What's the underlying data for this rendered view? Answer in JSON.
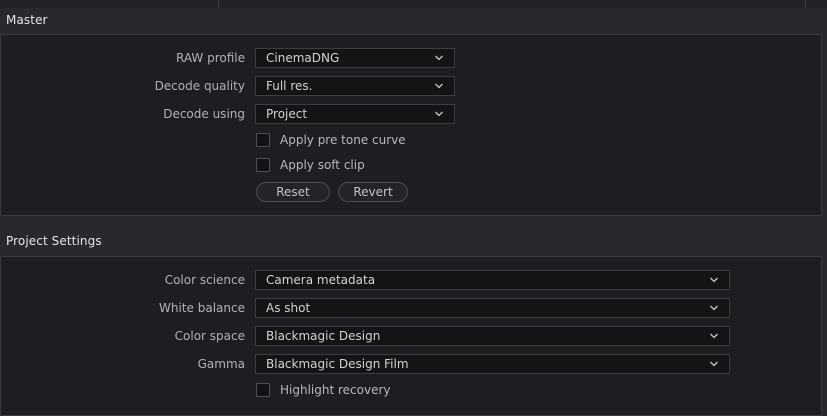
{
  "master": {
    "title": "Master",
    "rows": [
      {
        "label": "RAW profile",
        "value": "CinemaDNG"
      },
      {
        "label": "Decode quality",
        "value": "Full res."
      },
      {
        "label": "Decode using",
        "value": "Project"
      }
    ],
    "checkboxes": [
      {
        "label": "Apply pre tone curve",
        "checked": false
      },
      {
        "label": "Apply soft clip",
        "checked": false
      }
    ],
    "buttons": {
      "reset": "Reset",
      "revert": "Revert"
    }
  },
  "project_settings": {
    "title": "Project Settings",
    "rows": [
      {
        "label": "Color science",
        "value": "Camera metadata"
      },
      {
        "label": "White balance",
        "value": "As shot"
      },
      {
        "label": "Color space",
        "value": "Blackmagic Design"
      },
      {
        "label": "Gamma",
        "value": "Blackmagic Design Film"
      }
    ],
    "checkboxes": [
      {
        "label": "Highlight recovery",
        "checked": false
      }
    ]
  },
  "colors": {
    "background": "#28282e",
    "panel": "#1e1e22",
    "field": "#141417"
  },
  "icons": {
    "dropdown": "chevron-down-icon",
    "checkbox": "checkbox-unchecked"
  }
}
